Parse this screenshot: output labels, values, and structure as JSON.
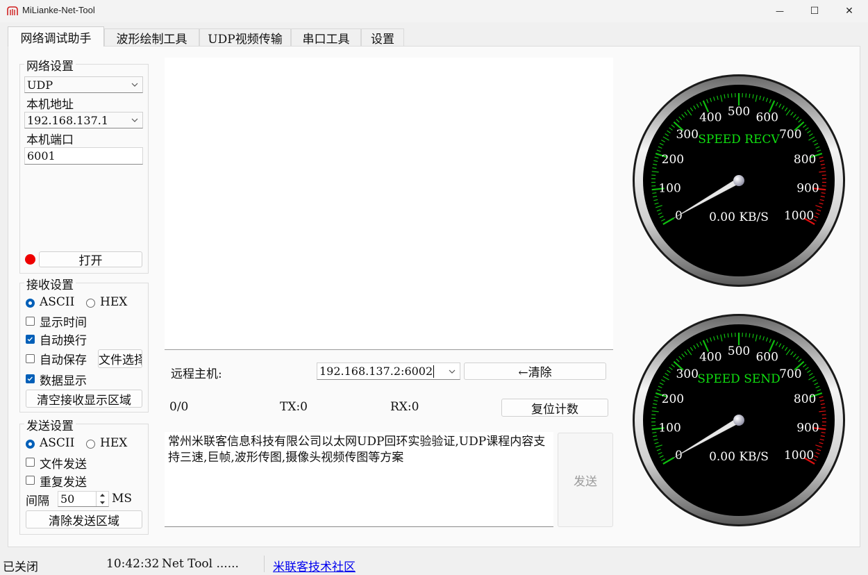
{
  "window": {
    "title": "MiLianke-Net-Tool",
    "minimize": "—",
    "maximize": "☐",
    "close": "✕"
  },
  "tabs": [
    "网络调试助手",
    "波形绘制工具",
    "UDP视频传输",
    "串口工具",
    "设置"
  ],
  "network": {
    "title": "网络设置",
    "protocol": "UDP",
    "local_addr_label": "本机地址",
    "local_addr": "192.168.137.1",
    "local_port_label": "本机端口",
    "local_port": "6001",
    "open_button": "打开",
    "status_color": "#ee0000"
  },
  "receive": {
    "title": "接收设置",
    "ascii": "ASCII",
    "hex": "HEX",
    "show_time": "显示时间",
    "auto_wrap": "自动换行",
    "auto_save": "自动保存",
    "file_select": "文件选择",
    "data_display": "数据显示",
    "clear_button": "清空接收显示区域"
  },
  "send": {
    "title": "发送设置",
    "ascii": "ASCII",
    "hex": "HEX",
    "file_send": "文件发送",
    "repeat_send": "重复发送",
    "interval_label": "间隔",
    "interval_value": "50",
    "interval_unit": "MS",
    "clear_button": "清除发送区域"
  },
  "remote": {
    "label": "远程主机:",
    "host": "192.168.137.2:6002",
    "clear_button": "←清除"
  },
  "counters": {
    "total": "0/0",
    "tx": "TX:0",
    "rx": "RX:0",
    "reset_button": "复位计数"
  },
  "send_area": {
    "text": "常州米联客信息科技有限公司以太网UDP回环实验验证,UDP课程内容支持三速,巨帧,波形传图,摄像头视频传图等方案",
    "send_button": "发送"
  },
  "gauges": [
    {
      "label": "SPEED RECV",
      "readout": "0.00 KB/S",
      "value": 0
    },
    {
      "label": "SPEED SEND",
      "readout": "0.00 KB/S",
      "value": 0
    }
  ],
  "gauge_scale": {
    "ticks": [
      "0",
      "100",
      "200",
      "300",
      "400",
      "500",
      "600",
      "700",
      "800",
      "900",
      "1000"
    ],
    "max": 1000,
    "label_color": "#10e010",
    "red_zone_from": 800
  },
  "statusbar": {
    "state": "已关闭",
    "time": "10:42:32",
    "message": "Net Tool ......",
    "link": "米联客技术社区"
  }
}
